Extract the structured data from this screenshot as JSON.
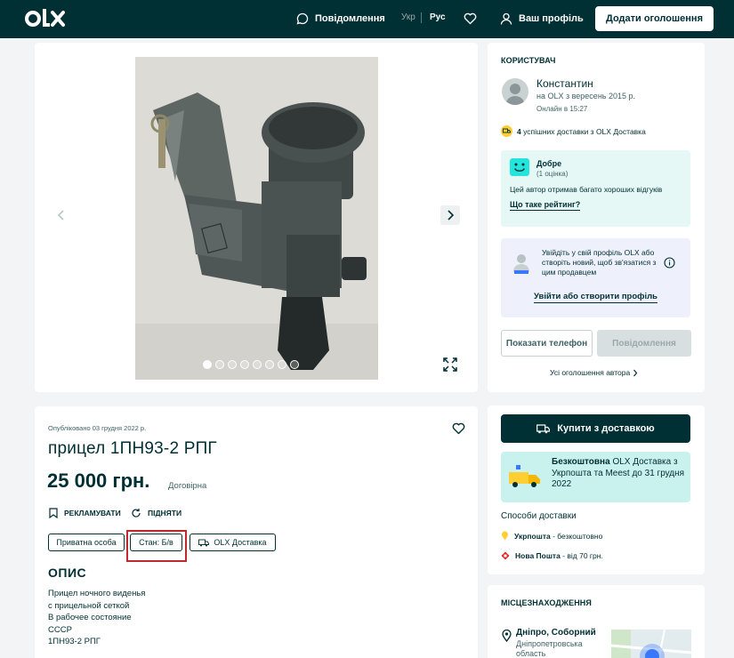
{
  "header": {
    "logo_text": "OLX",
    "messages_label": "Повідомлення",
    "lang_ukr": "Укр",
    "lang_rus": "Рус",
    "profile_label": "Ваш профіль",
    "add_button": "Додати оголошення"
  },
  "gallery": {
    "total_images": 8,
    "active_index": 0
  },
  "user": {
    "section_title": "КОРИСТУВАЧ",
    "name": "Константин",
    "member_since": "на OLX з вересень 2015 р.",
    "last_online": "Онлайн в 15:27",
    "deliveries_count": "4",
    "deliveries_text": "успішних доставки з OLX Доставка",
    "rating_title": "Добре",
    "rating_count": "(1 оцінка)",
    "rating_desc": "Цей автор отримав багато хороших відгуків",
    "rating_link": "Що таке рейтинг?",
    "login_text": "Увійдіть у свій профіль OLX або створіть новий, щоб зв'язатися з цим продавцем",
    "login_link": "Увійти або створити профіль",
    "show_phone": "Показати телефон",
    "message_button": "Повідомлення",
    "all_ads_link": "Усі оголошення автора"
  },
  "listing": {
    "published": "Опубліковано 03 грудня 2022 р.",
    "title": "прицел 1ПН93-2 РПГ",
    "price": "25 000 грн.",
    "negotiable": "Договірна",
    "promote": "РЕКЛАМУВАТИ",
    "raise": "ПІДНЯТИ",
    "chip_private": "Приватна особа",
    "chip_condition": "Стан: Б/в",
    "chip_delivery": "OLX Доставка",
    "description_title": "ОПИС",
    "description_lines": [
      "Прицел ночного виденья",
      "с прицельной сеткой",
      "В рабочее состояние",
      "СССР",
      "1ПН93-2 РПГ"
    ]
  },
  "delivery": {
    "buy_button": "Купити з доставкою",
    "promo_bold": "Безкоштовна",
    "promo_rest": " OLX Доставка з Укрпошта та Meest до 31 грудня 2022",
    "methods_title": "Способи доставки",
    "ukrposhta_name": "Укрпошта",
    "ukrposhta_price": " - безкоштовно",
    "novaposhta_name": "Нова Пошта",
    "novaposhta_price": " - від 70 грн."
  },
  "location": {
    "section_title": "МІСЦЕЗНАХОДЖЕННЯ",
    "city": "Дніпро, Соборний",
    "region": "Дніпропетровська",
    "region_suffix": "область"
  },
  "colors": {
    "brand_dark": "#002f34",
    "highlight_red": "#c0282f",
    "rating_bg": "#e6f8f6",
    "promo_bg": "#c9f2ef"
  }
}
